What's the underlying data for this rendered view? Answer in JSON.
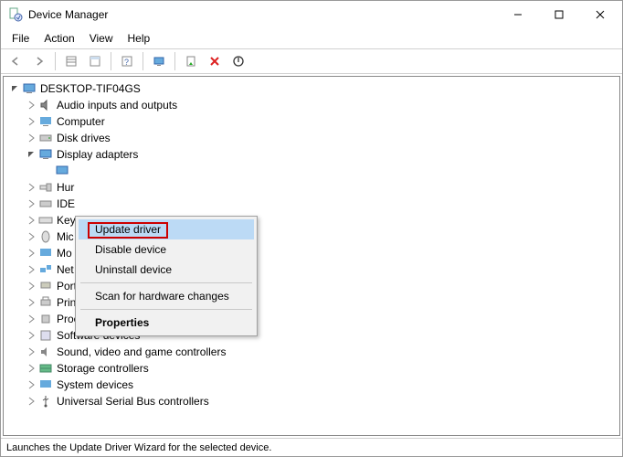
{
  "window": {
    "title": "Device Manager"
  },
  "menu": {
    "file": "File",
    "action": "Action",
    "view": "View",
    "help": "Help"
  },
  "tree": {
    "root": "DESKTOP-TIF04GS",
    "items": [
      "Audio inputs and outputs",
      "Computer",
      "Disk drives",
      "Display adapters",
      "Hur",
      "IDE",
      "Key",
      "Mic",
      "Mo",
      "Net",
      "Ports (COM & LPT)",
      "Print queues",
      "Processors",
      "Software devices",
      "Sound, video and game controllers",
      "Storage controllers",
      "System devices",
      "Universal Serial Bus controllers"
    ]
  },
  "context_menu": {
    "update": "Update driver",
    "disable": "Disable device",
    "uninstall": "Uninstall device",
    "scan": "Scan for hardware changes",
    "properties": "Properties"
  },
  "status": "Launches the Update Driver Wizard for the selected device."
}
